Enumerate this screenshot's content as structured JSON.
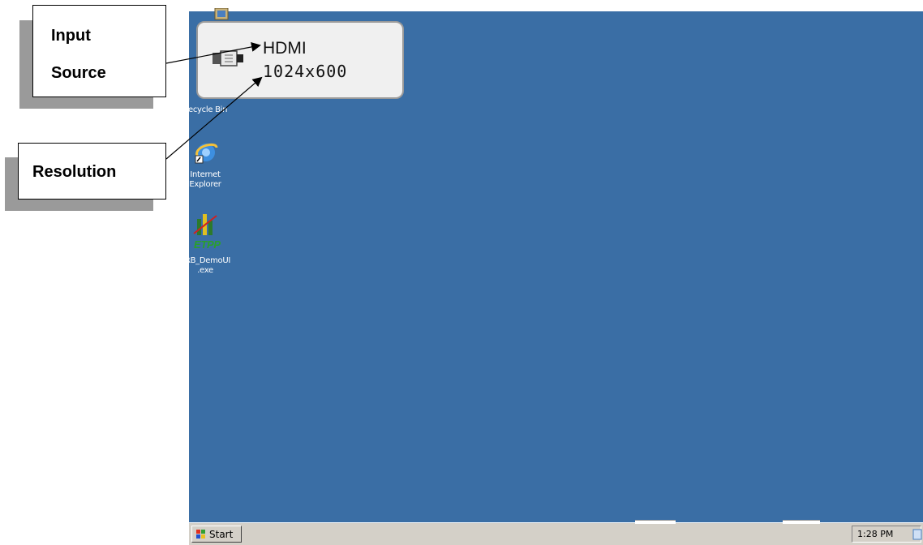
{
  "callouts": {
    "input_source_line1": "Input",
    "input_source_line2": "Source",
    "resolution": "Resolution"
  },
  "osd": {
    "source": "HDMI",
    "resolution": "1024x600",
    "icon": "hdmi-connector-icon"
  },
  "desktop": {
    "background": "#3a6ea5",
    "icons": [
      {
        "name": "my-computer-icon",
        "label_line1": "",
        "label_line2": ""
      },
      {
        "name": "recycle-bin-icon",
        "label_line1": "Recycle Bin",
        "label_line2": ""
      },
      {
        "name": "internet-explorer-icon",
        "label_line1": "Internet",
        "label_line2": "Explorer"
      },
      {
        "name": "etpp-app-icon",
        "label_line1": "ERB_DemoUI",
        "label_line2": ".exe"
      }
    ]
  },
  "taskbar": {
    "start_label": "Start",
    "clock": "1:28 PM"
  }
}
